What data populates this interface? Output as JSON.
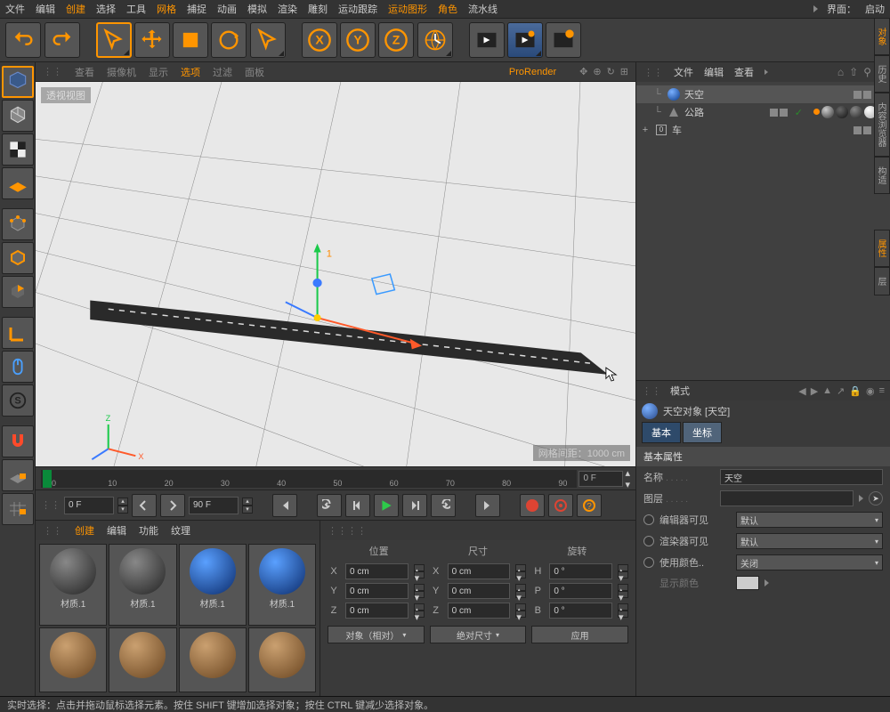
{
  "menubar": {
    "items": [
      "文件",
      "编辑",
      "创建",
      "选择",
      "工具",
      "网格",
      "捕捉",
      "动画",
      "模拟",
      "渲染",
      "雕刻",
      "运动跟踪",
      "运动图形",
      "角色",
      "流水线"
    ],
    "hl_idx": [
      2,
      5,
      12,
      13
    ],
    "right_label": "界面：",
    "right_value": "启动"
  },
  "viewport": {
    "tabs": [
      "查看",
      "摄像机",
      "显示",
      "选项",
      "过滤",
      "面板"
    ],
    "hl_idx": 3,
    "prorender": "ProRender",
    "label": "透视视图",
    "grid_info": "网格间距：1000 cm"
  },
  "timeline": {
    "ticks": [
      "0",
      "10",
      "20",
      "30",
      "40",
      "50",
      "60",
      "70",
      "80",
      "90"
    ],
    "current": "0 F",
    "start": "0 F",
    "end": "90 F"
  },
  "materials": {
    "tabs": [
      "创建",
      "编辑",
      "功能",
      "纹理"
    ],
    "hl_idx": 0,
    "items": [
      {
        "name": "材质.1",
        "type": "grey"
      },
      {
        "name": "材质.1",
        "type": "grey"
      },
      {
        "name": "材质.1",
        "type": "blue"
      },
      {
        "name": "材质.1",
        "type": "blue"
      },
      {
        "name": "",
        "type": "rock"
      },
      {
        "name": "",
        "type": "rock"
      },
      {
        "name": "",
        "type": "rock"
      },
      {
        "name": "",
        "type": "rock"
      }
    ]
  },
  "coords": {
    "hdr": [
      "位置",
      "尺寸",
      "旋转"
    ],
    "rows": [
      {
        "a": "X",
        "pos": "0 cm",
        "sz_a": "X",
        "sz": "0 cm",
        "rot_a": "H",
        "rot": "0 °"
      },
      {
        "a": "Y",
        "pos": "0 cm",
        "sz_a": "Y",
        "sz": "0 cm",
        "rot_a": "P",
        "rot": "0 °"
      },
      {
        "a": "Z",
        "pos": "0 cm",
        "sz_a": "Z",
        "sz": "0 cm",
        "rot_a": "B",
        "rot": "0 °"
      }
    ],
    "btns": [
      "对象（相对）",
      "绝对尺寸",
      "应用"
    ]
  },
  "objects": {
    "hdr": [
      "文件",
      "编辑",
      "查看"
    ],
    "rows": [
      {
        "name": "天空",
        "sel": true,
        "icon": "sky"
      },
      {
        "name": "公路",
        "sel": false,
        "icon": "road"
      },
      {
        "name": "车",
        "sel": false,
        "icon": "null",
        "exp": "+"
      }
    ]
  },
  "attrs": {
    "mode": "模式",
    "title": "天空对象 [天空]",
    "tabs": [
      "基本",
      "坐标"
    ],
    "section": "基本属性",
    "name_label": "名称",
    "name_value": "天空",
    "layer_label": "图层",
    "vis_editor": "编辑器可见",
    "vis_render": "渲染器可见",
    "use_color": "使用颜色..",
    "disp_color": "显示颜色",
    "default": "默认",
    "off": "关闭"
  },
  "sidetabs": [
    "对象",
    "历史",
    "内容浏览器",
    "构造",
    "属性",
    "层"
  ],
  "status": "实时选择：点击并拖动鼠标选择元素。按住 SHIFT 键增加选择对象；按住 CTRL 键减少选择对象。"
}
